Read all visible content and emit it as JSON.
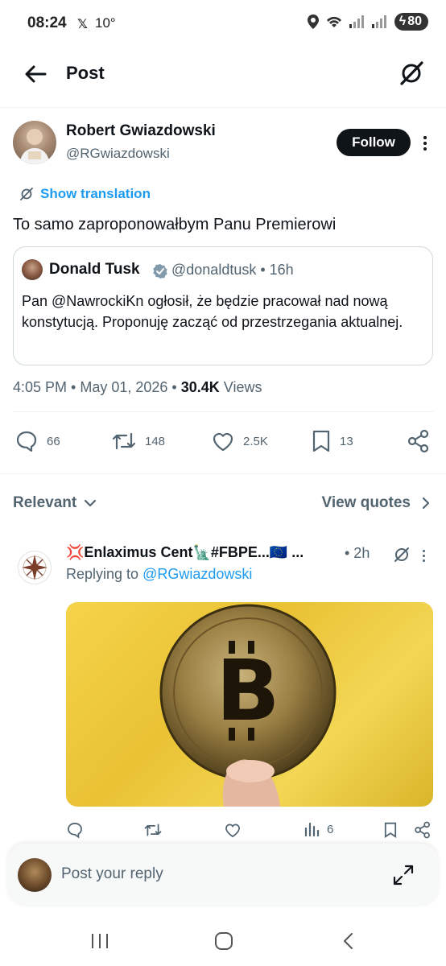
{
  "status_bar": {
    "time": "08:24",
    "x_label": "𝕏",
    "temperature": "10°",
    "battery": "80"
  },
  "header": {
    "title": "Post"
  },
  "post": {
    "author_name": "Robert Gwiazdowski",
    "author_handle": "@RGwiazdowski",
    "follow_label": "Follow",
    "show_translation": "Show translation",
    "text": "To samo zaproponowałbym Panu Premierowi",
    "quote": {
      "name": "Donald Tusk",
      "handle_time": "@donaldtusk • 16h",
      "text": "Pan @NawrockiKn ogłosił, że będzie pracował nad nową konstytucją. Proponuję zacząć od przestrzegania aktualnej."
    },
    "timestamp": "4:05 PM • May 01, 2026 • ",
    "views_count": "30.4K",
    "views_label": " Views",
    "actions": {
      "replies": "66",
      "reposts": "148",
      "likes": "2.5K",
      "bookmarks": "13"
    }
  },
  "sort": {
    "relevant_label": "Relevant",
    "view_quotes_label": "View quotes"
  },
  "reply": {
    "name": "💢Enlaximus Cent🗽#FBPE...🇪🇺 ...",
    "time": "• 2h",
    "replying_prefix": "Replying to ",
    "replying_to": "@RGwiazdowski",
    "views": "6"
  },
  "composer": {
    "placeholder": "Post your reply"
  },
  "colors": {
    "accent": "#1d9bf0",
    "text": "#0f1419",
    "muted": "#536471"
  }
}
